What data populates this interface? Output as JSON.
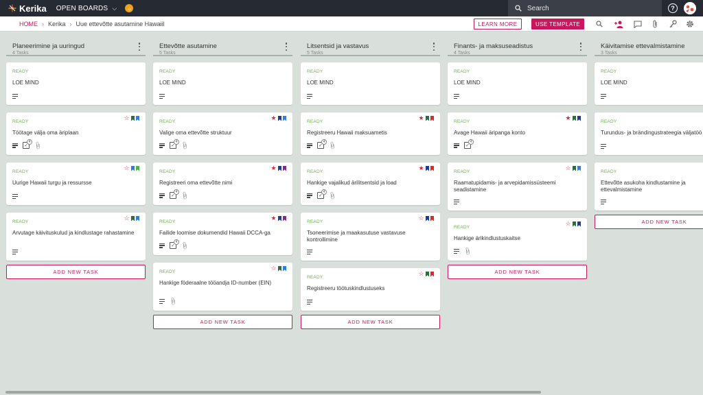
{
  "topbar": {
    "logo_text": "Kerika",
    "open_boards_label": "OPEN BOARDS",
    "search_placeholder": "Search",
    "help_label": "?"
  },
  "subbar": {
    "breadcrumb": {
      "home": "HOME",
      "org": "Kerika",
      "board": "Uue ettevõtte asutamine Hawaiil"
    },
    "learn_more_label": "LEARN MORE",
    "use_template_label": "USE TEMPLATE"
  },
  "colors": {
    "accent": "#c8175d",
    "status_ready": "#6ab04c",
    "star_red": "#e0263b",
    "flag_green": "#2e6b3f",
    "flag_blue": "#2f7fd6",
    "flag_navy": "#213c8f",
    "flag_purple": "#7b2d8e",
    "flag_red": "#d92a2a",
    "flag_lightgreen": "#4caf50"
  },
  "columns": [
    {
      "title": "Planeerimine ja uuringud",
      "count": "4 Tasks",
      "add_label": "ADD NEW TASK",
      "cards": [
        {
          "status": "READY",
          "title": "LOE MIND",
          "star": "none",
          "flags": [],
          "desc": true,
          "checklist": null,
          "attach": false
        },
        {
          "status": "READY",
          "title": "Töötage välja oma äriplaan",
          "star": "outline",
          "flags": [
            "green",
            "blue"
          ],
          "desc": true,
          "checklist": "4",
          "attach": true
        },
        {
          "status": "READY",
          "title": "Uurige Hawaii turgu ja ressursse",
          "star": "outline",
          "flags": [
            "blue",
            "lightgreen"
          ],
          "desc": true,
          "checklist": null,
          "attach": false
        },
        {
          "status": "READY",
          "title": "Arvutage käivituskulud ja kindlustage rahastamine",
          "star": "outline",
          "flags": [
            "green",
            "blue"
          ],
          "desc": true,
          "checklist": null,
          "attach": false
        }
      ]
    },
    {
      "title": "Ettevõtte asutamine",
      "count": "5 Tasks",
      "add_label": "ADD NEW TASK",
      "cards": [
        {
          "status": "READY",
          "title": "LOE MIND",
          "star": "none",
          "flags": [],
          "desc": true,
          "checklist": null,
          "attach": false
        },
        {
          "status": "READY",
          "title": "Valige oma ettevõtte struktuur",
          "star": "filled",
          "flags": [
            "navy",
            "blue"
          ],
          "desc": true,
          "checklist": "4",
          "attach": true
        },
        {
          "status": "READY",
          "title": "Registreeri oma ettevõtte nimi",
          "star": "filled",
          "flags": [
            "navy",
            "purple"
          ],
          "desc": true,
          "checklist": "4",
          "attach": true
        },
        {
          "status": "READY",
          "title": "Failide loomise dokumendid Hawaii DCCA-ga",
          "star": "filled",
          "flags": [
            "navy",
            "purple"
          ],
          "desc": true,
          "checklist": "4",
          "attach": true
        },
        {
          "status": "READY",
          "title": "Hankige föderaalne tööandja ID-number (EIN)",
          "star": "outline",
          "flags": [
            "green",
            "blue"
          ],
          "desc": true,
          "checklist": null,
          "attach": true
        }
      ]
    },
    {
      "title": "Litsentsid ja vastavus",
      "count": "5 Tasks",
      "add_label": "ADD NEW TASK",
      "cards": [
        {
          "status": "READY",
          "title": "LOE MIND",
          "star": "none",
          "flags": [],
          "desc": true,
          "checklist": null,
          "attach": false
        },
        {
          "status": "READY",
          "title": "Registreeru Hawaii maksuametis",
          "star": "filled",
          "flags": [
            "green",
            "red"
          ],
          "desc": true,
          "checklist": "4",
          "attach": true
        },
        {
          "status": "READY",
          "title": "Hankige vajalikud ärilitsentsid ja load",
          "star": "filled",
          "flags": [
            "navy",
            "red"
          ],
          "desc": true,
          "checklist": "4",
          "attach": true
        },
        {
          "status": "READY",
          "title": "Tsoneerimise ja maakasutuse vastavuse kontrollimine",
          "star": "outline",
          "flags": [
            "navy",
            "red"
          ],
          "desc": true,
          "checklist": null,
          "attach": false
        },
        {
          "status": "READY",
          "title": "Registreeru töötuskindlustuseks",
          "star": "outline",
          "flags": [
            "green",
            "red"
          ],
          "desc": true,
          "checklist": null,
          "attach": false
        }
      ]
    },
    {
      "title": "Finants- ja maksuseadistus",
      "count": "4 Tasks",
      "add_label": "ADD NEW TASK",
      "cards": [
        {
          "status": "READY",
          "title": "LOE MIND",
          "star": "none",
          "flags": [],
          "desc": true,
          "checklist": null,
          "attach": false
        },
        {
          "status": "READY",
          "title": "Avage Hawaii äripanga konto",
          "star": "filled",
          "flags": [
            "green",
            "navy"
          ],
          "desc": true,
          "checklist": "4",
          "attach": false
        },
        {
          "status": "READY",
          "title": "Raamatupidamis- ja arvepidamissüsteemi seadistamine",
          "star": "outline",
          "flags": [
            "green",
            "blue"
          ],
          "desc": true,
          "checklist": null,
          "attach": false
        },
        {
          "status": "READY",
          "title": "Hankige ärikindlustuskaitse",
          "star": "outline",
          "flags": [
            "green",
            "navy"
          ],
          "desc": true,
          "checklist": null,
          "attach": true
        }
      ]
    },
    {
      "title": "Käivitamise ettevalmistamine",
      "count": "3 Tasks",
      "add_label": "ADD NEW TASK",
      "cards": [
        {
          "status": "READY",
          "title": "LOE MIND",
          "star": "none",
          "flags": [],
          "desc": true,
          "checklist": null,
          "attach": false
        },
        {
          "status": "READY",
          "title": "Turundus- ja brändingustrateegia väljatöö",
          "star": "none",
          "flags": [],
          "desc": true,
          "checklist": null,
          "attach": false
        },
        {
          "status": "READY",
          "title": "Ettevõtte asukoha kindlustamine ja ettevalmistamine",
          "star": "outline",
          "flags": [
            "green",
            "blue"
          ],
          "desc": true,
          "checklist": null,
          "attach": false
        }
      ]
    }
  ]
}
